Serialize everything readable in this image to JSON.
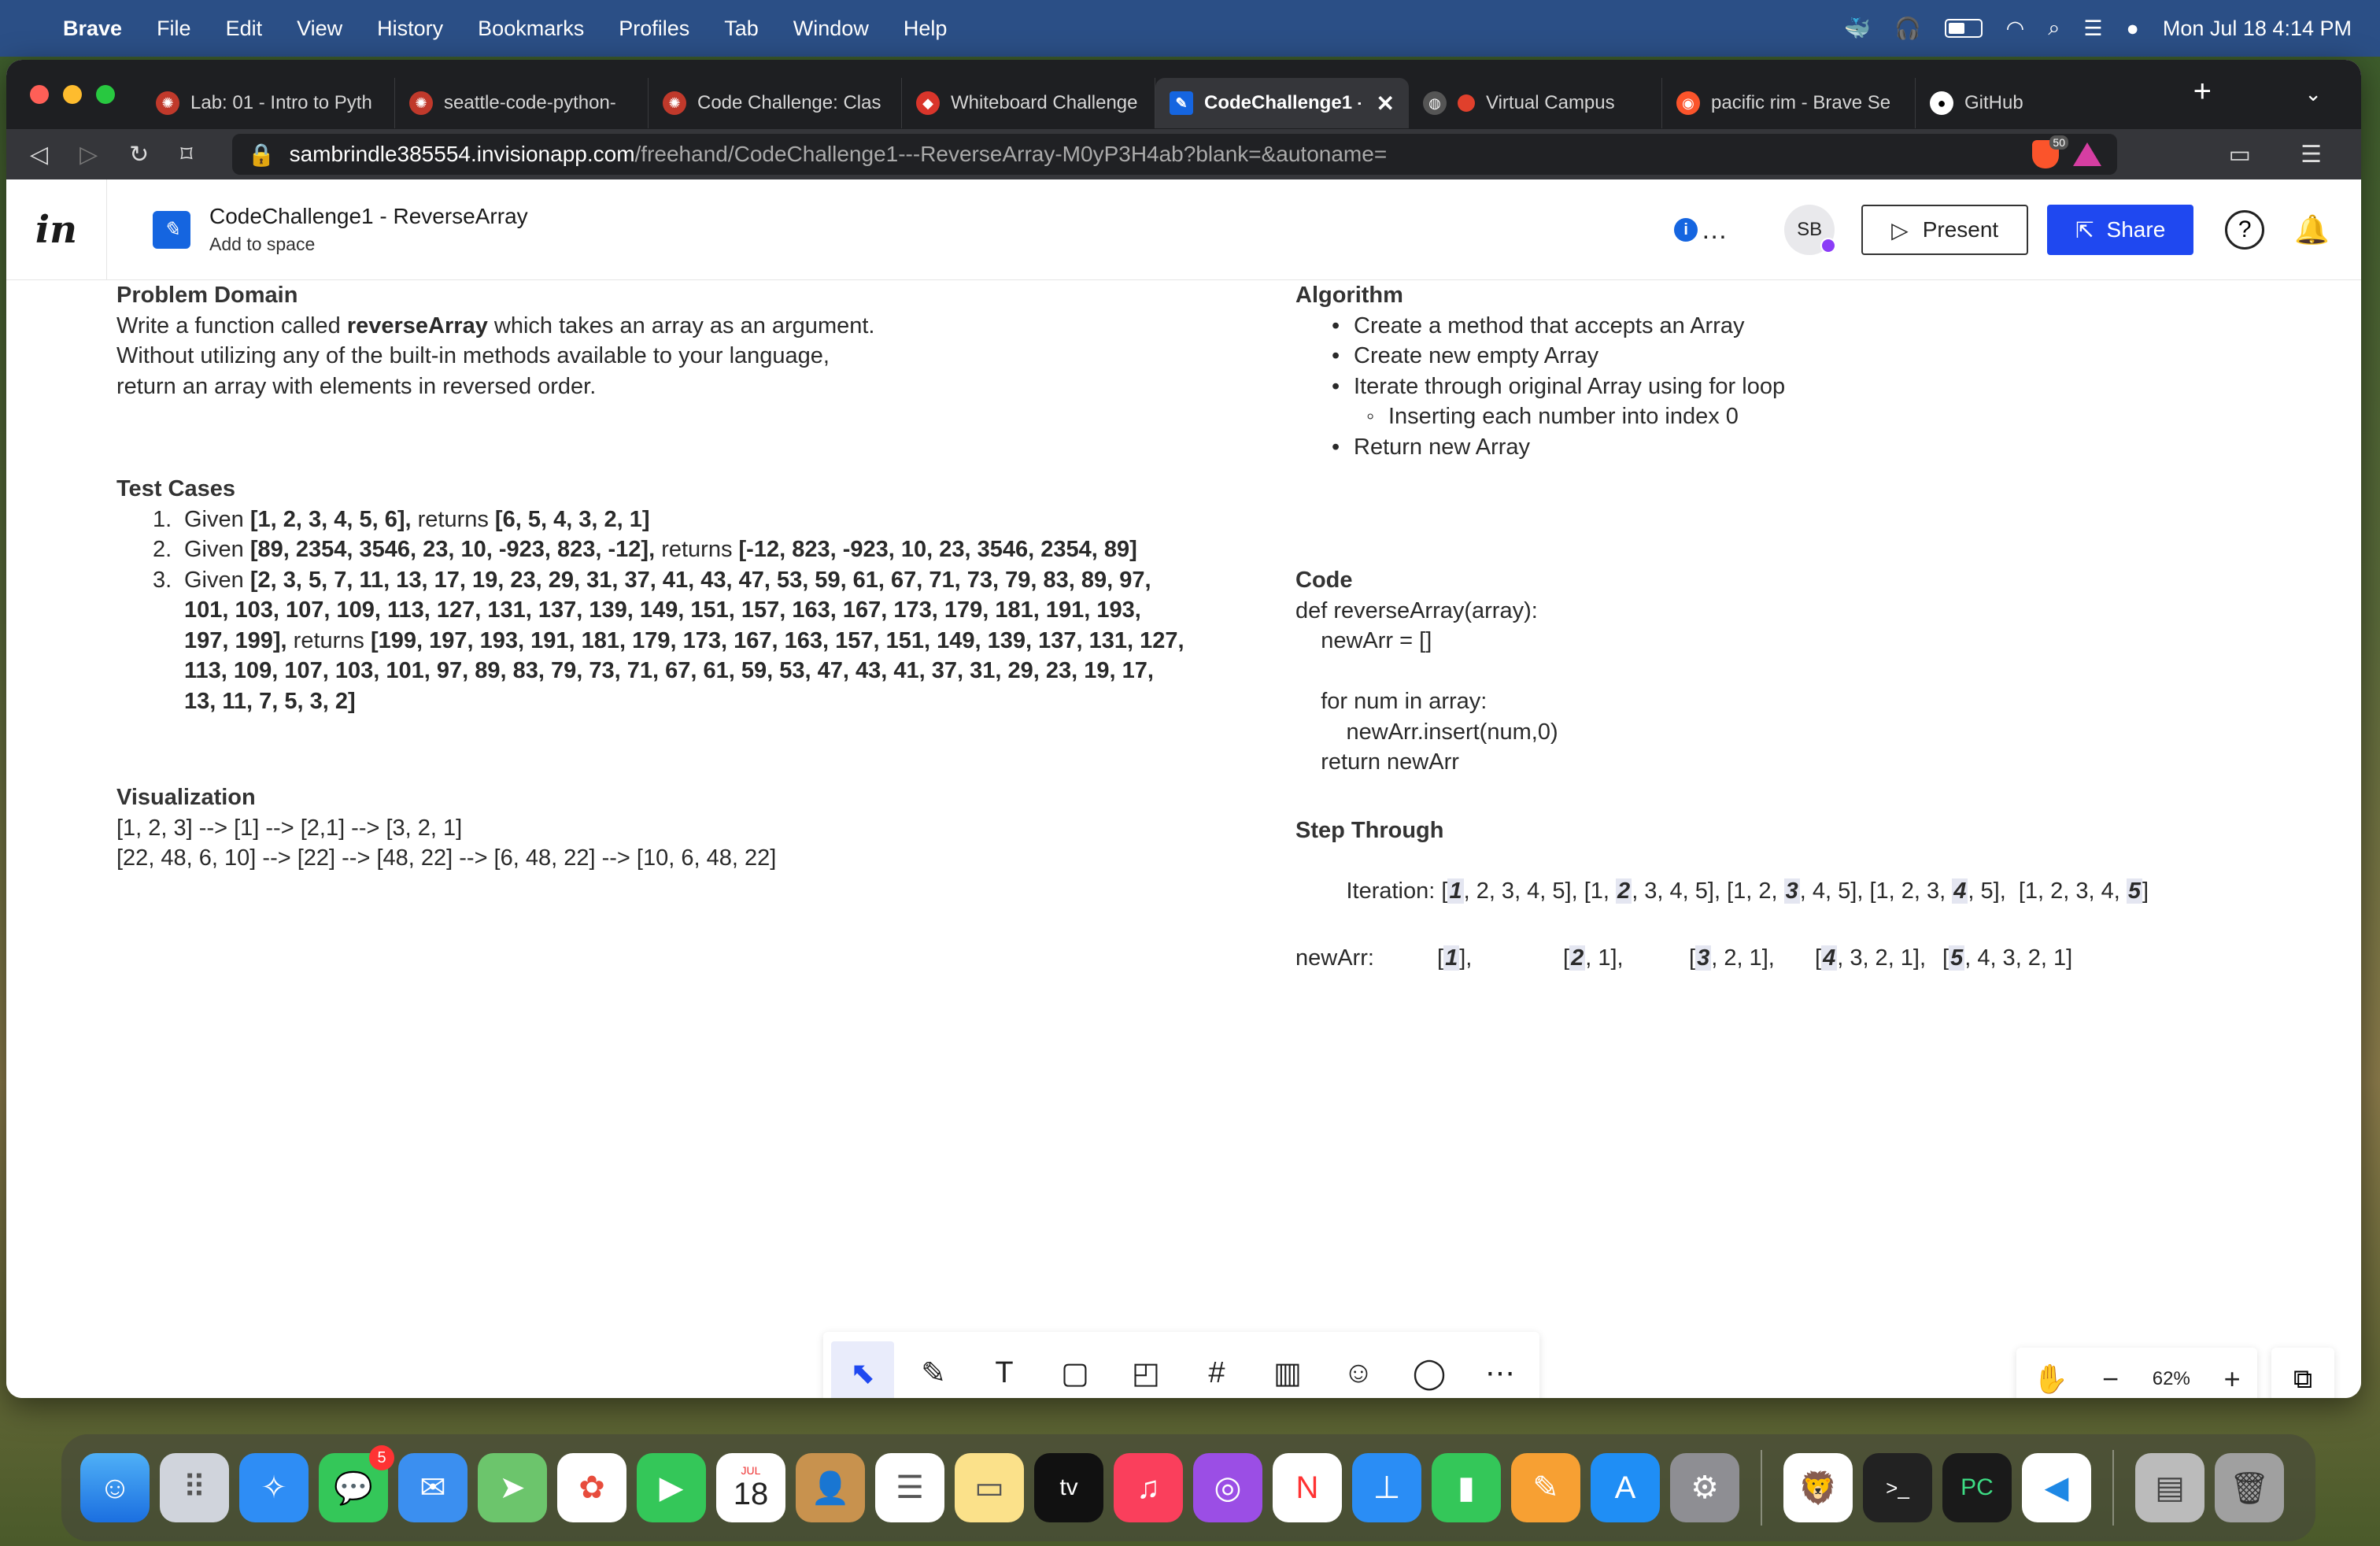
{
  "menubar": {
    "app": "Brave",
    "items": [
      "File",
      "Edit",
      "View",
      "History",
      "Bookmarks",
      "Profiles",
      "Tab",
      "Window",
      "Help"
    ],
    "datetime": "Mon Jul 18  4:14 PM"
  },
  "tabs": [
    {
      "label": "Lab: 01 - Intro to Pyth",
      "color": "#c0392b",
      "icon": "canvas-icon"
    },
    {
      "label": "seattle-code-python-",
      "color": "#c0392b",
      "icon": "canvas-icon"
    },
    {
      "label": "Code Challenge: Clas",
      "color": "#c0392b",
      "icon": "canvas-icon"
    },
    {
      "label": "Whiteboard Challenge",
      "color": "#d9352b",
      "icon": "codefellows-icon"
    },
    {
      "label": "CodeChallenge1 -",
      "color": "#1565e0",
      "icon": "invision-freehand-icon",
      "active": true
    },
    {
      "label": "Virtual Campus",
      "color": "#e0402c",
      "icon": "record-icon"
    },
    {
      "label": "pacific rim - Brave Se",
      "color": "#fb542b",
      "icon": "brave-search-icon"
    },
    {
      "label": "GitHub",
      "color": "#ffffff",
      "icon": "github-icon"
    }
  ],
  "address": {
    "host": "sambrindle385554.invisionapp.com",
    "path": "/freehand/CodeChallenge1---ReverseArray-M0yP3H4ab?blank=&autoname=",
    "shield_count": "50"
  },
  "header": {
    "logo": "in",
    "title": "CodeChallenge1 - ReverseArray",
    "subtitle": "Add to space",
    "avatar": "SB",
    "present": "Present",
    "share": "Share"
  },
  "problem": {
    "heading": "Problem Domain",
    "line1_pre": "Write a function called ",
    "line1_bold": "reverseArray",
    "line1_post": " which takes an array as an argument.",
    "line2": "Without utilizing any of the built-in methods available to your language,",
    "line3": "return an array with elements in reversed order."
  },
  "tests": {
    "heading": "Test Cases",
    "items": [
      {
        "num": "1.",
        "given": "Given ",
        "input": "[1, 2, 3, 4, 5, 6],",
        "returns": " returns ",
        "output": "[6, 5, 4, 3, 2, 1]"
      },
      {
        "num": "2.",
        "given": "Given ",
        "input": "[89, 2354, 3546, 23, 10, -923, 823, -12],",
        "returns": " returns ",
        "output": "[-12, 823, -923, 10, 23, 3546, 2354, 89]"
      },
      {
        "num": "3.",
        "given": "Given ",
        "input": "[2, 3, 5, 7, 11, 13, 17, 19, 23, 29, 31, 37, 41, 43, 47, 53, 59, 61, 67, 71, 73, 79, 83, 89, 97, 101, 103, 107, 109, 113, 127, 131, 137, 139, 149, 151, 157, 163, 167, 173, 179, 181, 191, 193, 197, 199],",
        "returns": " returns ",
        "output": "[199, 197, 193, 191, 181, 179, 173, 167, 163, 157, 151, 149, 139, 137, 131, 127, 113, 109, 107, 103, 101, 97, 89, 83, 79, 73, 71, 67, 61, 59, 53, 47, 43, 41, 37, 31, 29, 23, 19, 17, 13, 11, 7, 5, 3, 2]"
      }
    ]
  },
  "visualization": {
    "heading": "Visualization",
    "line1": "[1, 2, 3] --> [1] --> [2,1] --> [3, 2, 1]",
    "line2": "[22, 48, 6, 10] --> [22] --> [48, 22] --> [6, 48, 22] --> [10, 6, 48, 22]"
  },
  "algorithm": {
    "heading": "Algorithm",
    "items": [
      "Create a method that accepts an Array",
      "Create new empty Array",
      "Iterate through original Array using for loop"
    ],
    "subitem": "Inserting each number into index 0",
    "last": "Return new Array"
  },
  "code": {
    "heading": "Code",
    "lines": [
      "def reverseArray(array):",
      "    newArr = []",
      "",
      "    for num in array:",
      "        newArr.insert(num,0)",
      "    return newArr"
    ]
  },
  "step": {
    "heading": "Step Through",
    "iteration_label": "Iteration: ",
    "iterations": [
      {
        "pre": "[",
        "hl": "1",
        "post": ", 2, 3, 4, 5], "
      },
      {
        "pre": "[1, ",
        "hl": "2",
        "post": ", 3, 4, 5], "
      },
      {
        "pre": "[1, 2, ",
        "hl": "3",
        "post": ", 4, 5], "
      },
      {
        "pre": "[1, 2, 3, ",
        "hl": "4",
        "post": ", 5],  "
      },
      {
        "pre": "[1, 2, 3, 4, ",
        "hl": "5",
        "post": "]"
      }
    ],
    "newarr_label": "newArr:",
    "newarr": [
      {
        "pre": "[",
        "hl": "1",
        "post": "],"
      },
      {
        "pre": "[",
        "hl": "2",
        "post": ", 1],"
      },
      {
        "pre": "[",
        "hl": "3",
        "post": ", 2, 1],"
      },
      {
        "pre": "[",
        "hl": "4",
        "post": ", 3, 2, 1],"
      },
      {
        "pre": "[",
        "hl": "5",
        "post": ", 4, 3, 2, 1]"
      }
    ]
  },
  "zoom": "62%",
  "dock": {
    "messages_badge": "5",
    "calendar_month": "JUL",
    "calendar_day": "18",
    "tv": "tv"
  }
}
